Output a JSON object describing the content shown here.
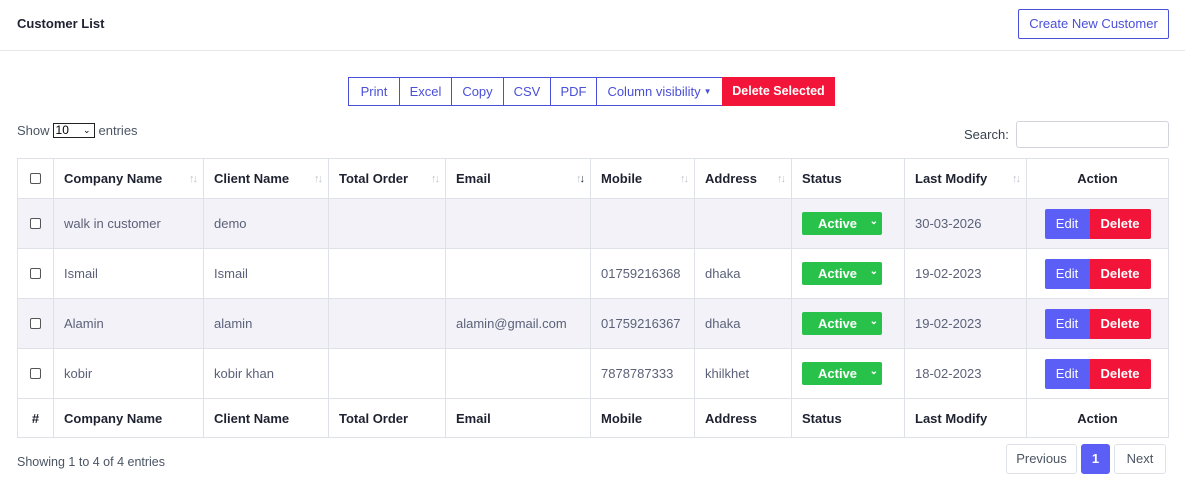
{
  "header": {
    "title": "Customer List",
    "create_button": "Create New Customer"
  },
  "export_buttons": {
    "print": "Print",
    "excel": "Excel",
    "copy": "Copy",
    "csv": "CSV",
    "pdf": "PDF",
    "column_visibility": "Column visibility",
    "delete_selected": "Delete Selected"
  },
  "length": {
    "show": "Show",
    "value": "10",
    "entries": "entries"
  },
  "search": {
    "label": "Search:",
    "value": ""
  },
  "columns": {
    "company": "Company Name",
    "client": "Client Name",
    "total": "Total Order",
    "email": "Email",
    "mobile": "Mobile",
    "address": "Address",
    "status": "Status",
    "modify": "Last Modify",
    "action": "Action"
  },
  "footer_columns": {
    "hash": "#",
    "company": "Company Name",
    "client": "Client Name",
    "total": "Total Order",
    "email": "Email",
    "mobile": "Mobile",
    "address": "Address",
    "status": "Status",
    "modify": "Last Modify",
    "action": "Action"
  },
  "rows": [
    {
      "company": "walk in customer",
      "client": "demo",
      "total": "",
      "email": "",
      "mobile": "",
      "address": "",
      "status": "Active",
      "modify": "30-03-2026",
      "edit": "Edit",
      "delete": "Delete"
    },
    {
      "company": "Ismail",
      "client": "Ismail",
      "total": "",
      "email": "",
      "mobile": "01759216368",
      "address": "dhaka",
      "status": "Active",
      "modify": "19-02-2023",
      "edit": "Edit",
      "delete": "Delete"
    },
    {
      "company": "Alamin",
      "client": "alamin",
      "total": "",
      "email": "alamin@gmail.com",
      "mobile": "01759216367",
      "address": "dhaka",
      "status": "Active",
      "modify": "19-02-2023",
      "edit": "Edit",
      "delete": "Delete"
    },
    {
      "company": "kobir",
      "client": "kobir khan",
      "total": "",
      "email": "",
      "mobile": "7878787333",
      "address": "khilkhet",
      "status": "Active",
      "modify": "18-02-2023",
      "edit": "Edit",
      "delete": "Delete"
    }
  ],
  "info": "Showing 1 to 4 of 4 entries",
  "pagination": {
    "previous": "Previous",
    "current": "1",
    "next": "Next"
  },
  "sort": {
    "active_column": "Email",
    "direction": "descending"
  },
  "icons": {
    "sort": "sort-arrows-icon",
    "dropdown": "chevron-down-icon"
  },
  "colors": {
    "accent": "#4a4fd8",
    "primary": "#5b5ff5",
    "danger": "#f21539",
    "success": "#28c24a"
  }
}
